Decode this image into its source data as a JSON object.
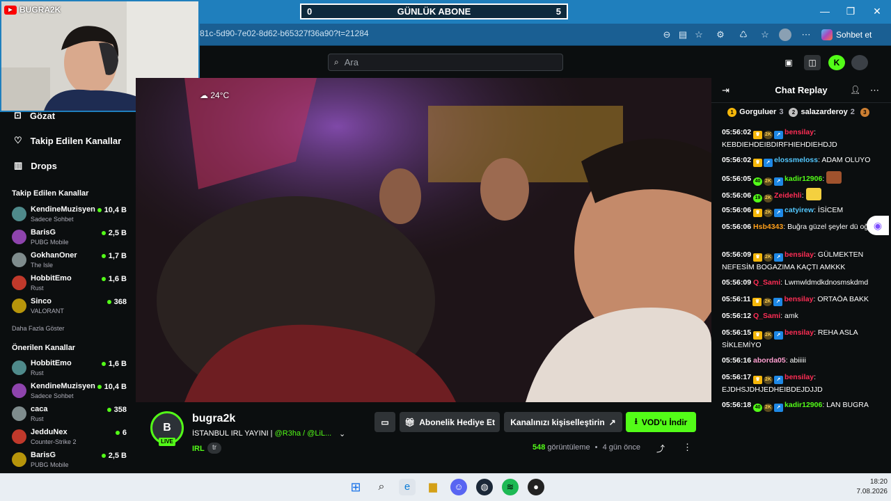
{
  "overlay": {
    "brand": "BUGRA2K",
    "counter_left": "0",
    "counter_title": "GÜNLÜK ABONE",
    "counter_right": "5"
  },
  "browser": {
    "url": "81c-5d90-7e02-8d62-b65327f36a90?t=21284",
    "copilot_label": "Sohbet et"
  },
  "header": {
    "search_placeholder": "Ara"
  },
  "sidebar": {
    "nav": [
      {
        "label": "Gözat",
        "icon": "browse-icon"
      },
      {
        "label": "Takip Edilen Kanallar",
        "icon": "heart-icon"
      },
      {
        "label": "Drops",
        "icon": "drops-icon"
      }
    ],
    "followed_title": "Takip Edilen Kanallar",
    "followed": [
      {
        "name": "KendineMuzisyen",
        "game": "Sadece Sohbet",
        "viewers": "10,4 B"
      },
      {
        "name": "BarisG",
        "game": "PUBG Mobile",
        "viewers": "2,5 B"
      },
      {
        "name": "GokhanOner",
        "game": "The Isle",
        "viewers": "1,7 B"
      },
      {
        "name": "HobbitEmo",
        "game": "Rust",
        "viewers": "1,6 B"
      },
      {
        "name": "Sinco",
        "game": "VALORANT",
        "viewers": "368"
      }
    ],
    "show_more": "Daha Fazla Göster",
    "recommended_title": "Önerilen Kanallar",
    "recommended": [
      {
        "name": "HobbitEmo",
        "game": "Rust",
        "viewers": "1,6 B"
      },
      {
        "name": "KendineMuzisyen",
        "game": "Sadece Sohbet",
        "viewers": "10,4 B"
      },
      {
        "name": "caca",
        "game": "Rust",
        "viewers": "358"
      },
      {
        "name": "JedduNex",
        "game": "Counter-Strike 2",
        "viewers": "6"
      },
      {
        "name": "BarisG",
        "game": "PUBG Mobile",
        "viewers": "2,5 B"
      }
    ]
  },
  "video": {
    "weather": "24°C"
  },
  "stream": {
    "channel": "bugra2k",
    "live_badge": "LIVE",
    "title_prefix": "İSTANBUL  IRL YAYINI | ",
    "title_mentions": "@R3ha / @LiL...",
    "category": "IRL",
    "language": "tr",
    "gift_label": "Abonelik Hediye Et",
    "customize_label": "Kanalınızı kişiselleştirin",
    "vod_label": "VOD'u İndir",
    "views_count": "548",
    "views_label": " görüntüleme",
    "time_ago": "4 gün önce"
  },
  "chat": {
    "title": "Chat Replay",
    "leaders": [
      {
        "rank": "1",
        "name": "Gorguluer",
        "count": "3",
        "color": "#f5b70a"
      },
      {
        "rank": "2",
        "name": "salazarderoy",
        "count": "2",
        "color": "#c0c0c0"
      },
      {
        "rank": "3",
        "name": "",
        "count": "",
        "color": "#cd7f32"
      }
    ],
    "messages": [
      {
        "time": "05:56:02",
        "user": "bensilay",
        "color": "#ff2d55",
        "text": "KEBDIEHDEIBDIRFHIEHDIEHDJD",
        "badges": [
          "crown",
          "2k",
          "blu"
        ]
      },
      {
        "time": "05:56:02",
        "user": "elossmeloss",
        "color": "#53c8ff",
        "text": "ADAM OLUYO",
        "badges": [
          "crown",
          "blu"
        ]
      },
      {
        "time": "05:56:05",
        "user": "kadir12906",
        "color": "#53fc18",
        "text": "",
        "badges": [
          "40",
          "2k",
          "blu"
        ],
        "emote": true
      },
      {
        "time": "05:56:06",
        "user": "Zeidehli",
        "color": "#ff2d55",
        "text": "",
        "badges": [
          "19",
          "2k"
        ],
        "emote": true
      },
      {
        "time": "05:56:06",
        "user": "catyirew",
        "color": "#53c8ff",
        "text": "İSİCEM",
        "badges": [
          "crown",
          "2k",
          "blu"
        ]
      },
      {
        "time": "05:56:06",
        "user": "Hsb4343",
        "color": "#ff9f1a",
        "text": "Buğra güzel şeyler dü oğlum",
        "badges": []
      },
      {
        "time": "05:56:09",
        "user": "bensilay",
        "color": "#ff2d55",
        "text": "GÜLMEKTEN NEFESİM BOGAZIMA KAÇTI AMKKK",
        "badges": [
          "crown",
          "2k",
          "blu"
        ]
      },
      {
        "time": "05:56:09",
        "user": "Q_Sami",
        "color": "#ff2d55",
        "text": "Lwmwldmdkdnosmskdmd",
        "badges": []
      },
      {
        "time": "05:56:11",
        "user": "bensilay",
        "color": "#ff2d55",
        "text": "ORTAÖA BAKK",
        "badges": [
          "crown",
          "2k",
          "blu"
        ]
      },
      {
        "time": "05:56:12",
        "user": "Q_Sami",
        "color": "#ff2d55",
        "text": "amk",
        "badges": []
      },
      {
        "time": "05:56:15",
        "user": "bensilay",
        "color": "#ff2d55",
        "text": "REHA ASLA SİKLEMİYO",
        "badges": [
          "crown",
          "2k",
          "blu"
        ]
      },
      {
        "time": "05:56:16",
        "user": "aborda05",
        "color": "#ff9fd0",
        "text": "abiiiii",
        "badges": []
      },
      {
        "time": "05:56:17",
        "user": "bensilay",
        "color": "#ff2d55",
        "text": "EJDHSJDHJEDHEIBDEJDJJD",
        "badges": [
          "crown",
          "2k",
          "blu"
        ]
      },
      {
        "time": "05:56:18",
        "user": "kadir12906",
        "color": "#53fc18",
        "text": "LAN BUGRA",
        "badges": [
          "40",
          "2k",
          "blu"
        ]
      }
    ]
  },
  "taskbar": {
    "time": "18:20",
    "date": "7.08.2026"
  },
  "colors": {
    "kick_green": "#53fc18",
    "browser_blue": "#1f7fbd",
    "dark_bg": "#0b0e0f"
  }
}
